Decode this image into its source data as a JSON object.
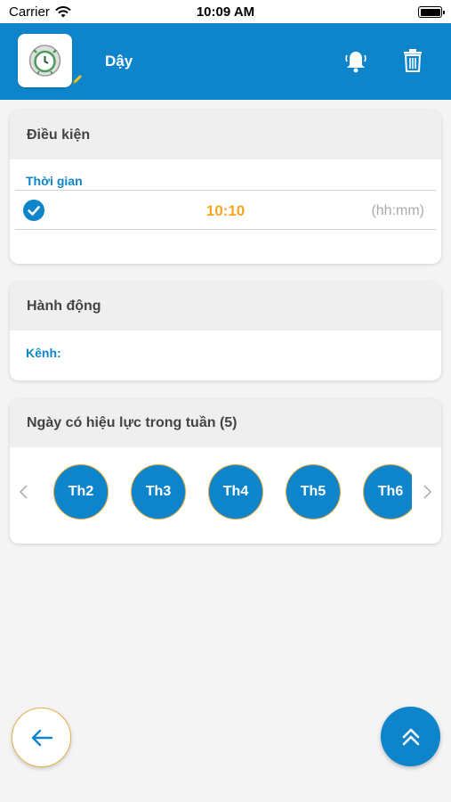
{
  "status_bar": {
    "carrier": "Carrier",
    "time": "10:09 AM"
  },
  "header": {
    "title": "Dậy",
    "icons": [
      "alarm-clock-icon",
      "edit-pencil-icon",
      "bell-icon",
      "trash-icon"
    ]
  },
  "condition": {
    "title": "Điều kiện",
    "time_label": "Thời gian",
    "time_value": "10:10",
    "time_format": "(hh:mm)",
    "checked": true
  },
  "action": {
    "title": "Hành động",
    "channel_label": "Kênh:"
  },
  "days": {
    "title": "Ngày có hiệu lực trong tuần (5)",
    "items": [
      "Th2",
      "Th3",
      "Th4",
      "Th5",
      "Th6"
    ]
  },
  "buttons": {
    "back": "arrow-left-icon",
    "scroll_top": "double-chevron-up-icon"
  },
  "colors": {
    "primary": "#0e85cb",
    "accent": "#f5a623"
  }
}
